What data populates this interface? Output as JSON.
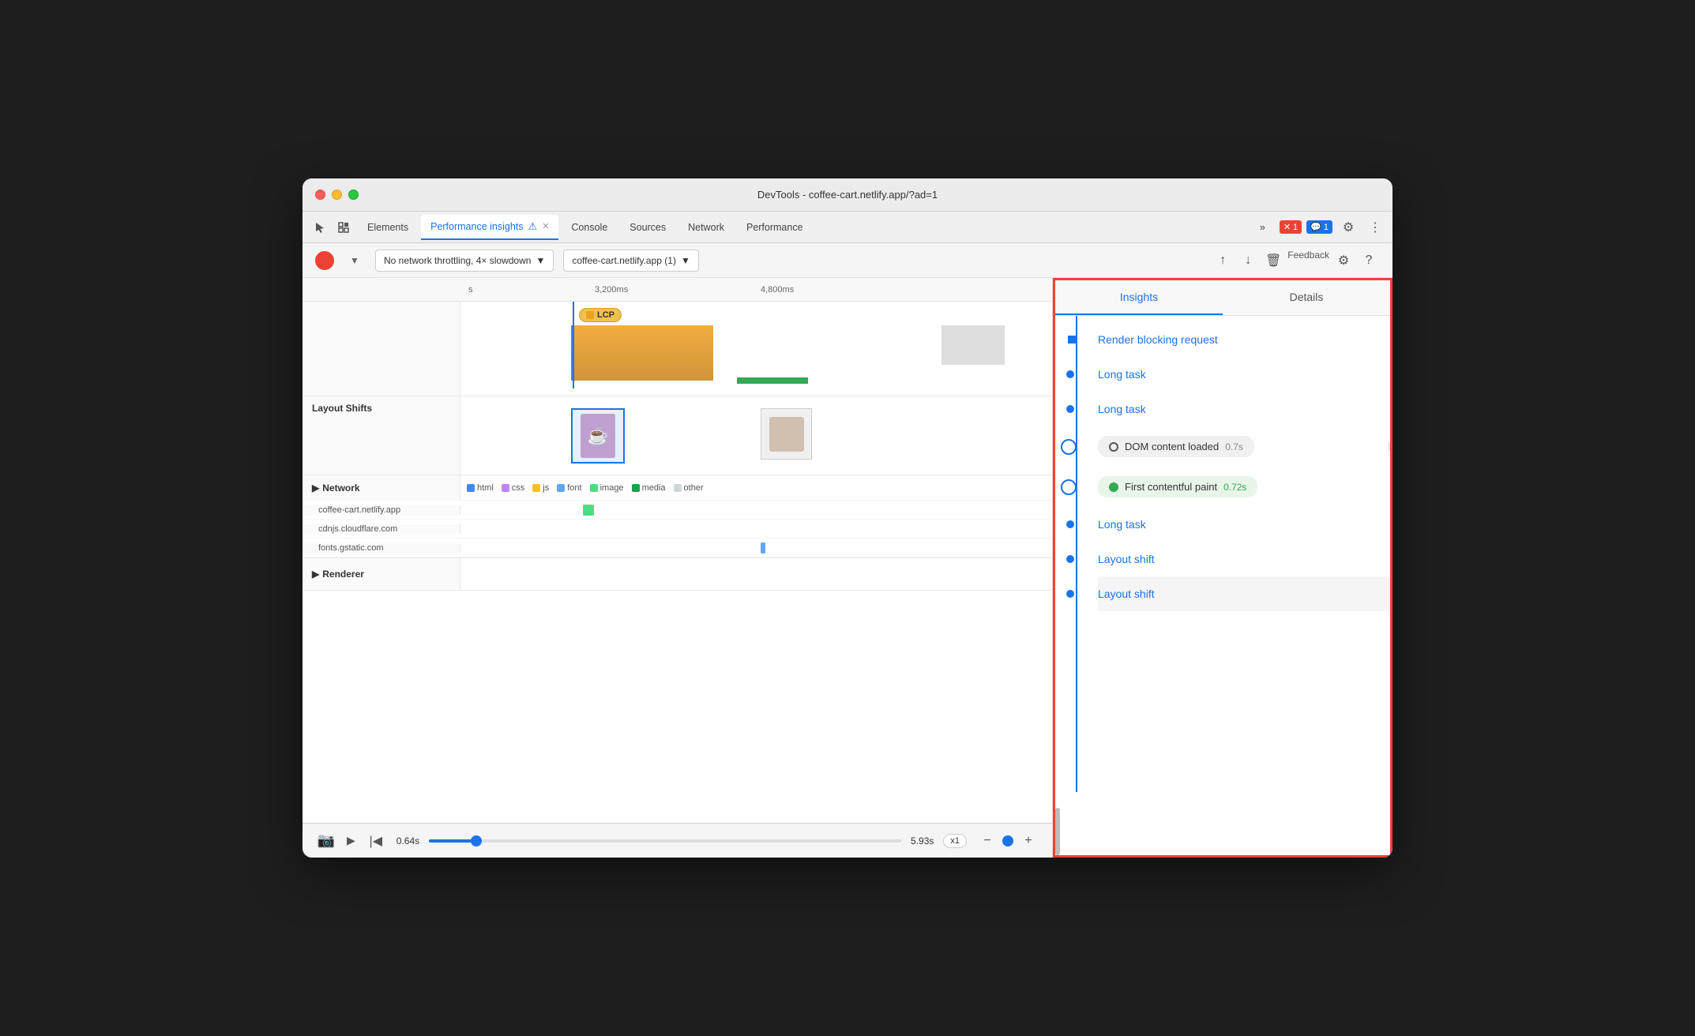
{
  "window": {
    "title": "DevTools - coffee-cart.netlify.app/?ad=1"
  },
  "tabs": {
    "items": [
      {
        "label": "Elements",
        "active": false
      },
      {
        "label": "Performance insights",
        "active": true
      },
      {
        "label": "Console",
        "active": false
      },
      {
        "label": "Sources",
        "active": false
      },
      {
        "label": "Network",
        "active": false
      },
      {
        "label": "Performance",
        "active": false
      }
    ],
    "more_label": "»",
    "error_count": "1",
    "message_count": "1"
  },
  "toolbar": {
    "network_throttle": "No network throttling, 4× slowdown",
    "site_select": "coffee-cart.netlify.app (1)",
    "feedback_label": "Feedback"
  },
  "timeline": {
    "time_markers": [
      "s",
      "3,200ms",
      "4,800ms"
    ],
    "lcp_label": "LCP",
    "layout_shifts_label": "Layout Shifts",
    "network_label": "Network",
    "renderer_label": "Renderer",
    "network_legend": [
      "html",
      "css",
      "js",
      "font",
      "image",
      "media",
      "other"
    ],
    "legend_colors": {
      "html": "#4285f4",
      "css": "#c084fc",
      "js": "#fbbf24",
      "font": "#60a5fa",
      "image": "#4ade80",
      "media": "#16a34a",
      "other": "#d1d5db"
    },
    "network_domains": [
      "coffee-cart.netlify.app",
      "cdnjs.cloudflare.com",
      "fonts.gstatic.com"
    ]
  },
  "bottom_bar": {
    "time_start": "0.64s",
    "time_end": "5.93s",
    "speed": "x1"
  },
  "insights": {
    "tab_insights": "Insights",
    "tab_details": "Details",
    "items": [
      {
        "type": "link",
        "label": "Render blocking request"
      },
      {
        "type": "link",
        "label": "Long task"
      },
      {
        "type": "link",
        "label": "Long task"
      },
      {
        "type": "milestone",
        "label": "DOM content loaded",
        "time": "0.7s",
        "style": "dom"
      },
      {
        "type": "milestone",
        "label": "First contentful paint",
        "time": "0.72s",
        "style": "fcp"
      },
      {
        "type": "link",
        "label": "Long task"
      },
      {
        "type": "link",
        "label": "Layout shift"
      },
      {
        "type": "link",
        "label": "Layout shift"
      }
    ]
  }
}
